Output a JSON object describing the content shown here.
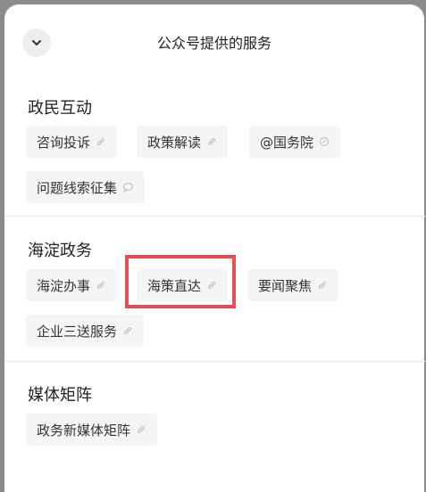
{
  "sheet": {
    "title": "公众号提供的服务",
    "collapse_icon": "chevron-down-icon"
  },
  "sections": [
    {
      "title": "政民互动",
      "items": [
        {
          "label": "咨询投诉",
          "icon": "link-icon"
        },
        {
          "label": "政策解读",
          "icon": "link-icon"
        },
        {
          "label": "@国务院",
          "icon": "miniprogram-icon"
        },
        {
          "label": "问题线索征集",
          "icon": "chat-bubble-icon"
        }
      ]
    },
    {
      "title": "海淀政务",
      "items": [
        {
          "label": "海淀办事",
          "icon": "link-icon"
        },
        {
          "label": "海策直达",
          "icon": "link-icon",
          "highlighted": true
        },
        {
          "label": "要闻聚焦",
          "icon": "link-icon"
        },
        {
          "label": "企业三送服务",
          "icon": "link-icon"
        }
      ]
    },
    {
      "title": "媒体矩阵",
      "items": [
        {
          "label": "政务新媒体矩阵",
          "icon": "link-icon"
        }
      ]
    }
  ],
  "colors": {
    "highlight_border": "#e94e52",
    "chip_background": "#f5f5f5",
    "sheet_background": "#ffffff"
  }
}
